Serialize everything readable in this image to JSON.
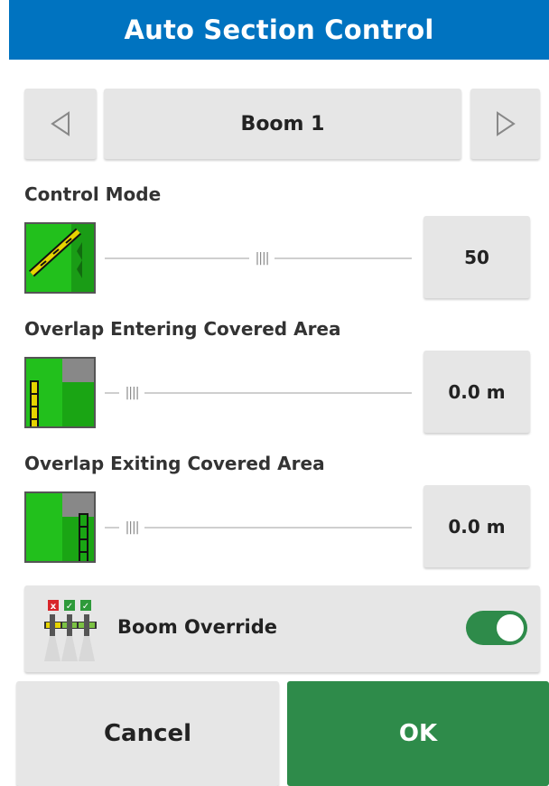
{
  "title": "Auto Section Control",
  "boom_selector": {
    "prev_icon": "triangle-left-icon",
    "next_icon": "triangle-right-icon",
    "label": "Boom 1"
  },
  "control_mode": {
    "label": "Control Mode",
    "icon": "control-mode-icon",
    "value": "50",
    "slider_fraction": 0.5
  },
  "overlap_entering": {
    "label": "Overlap Entering Covered Area",
    "icon": "overlap-entering-icon",
    "value": "0.0 m",
    "slider_fraction": 0.0
  },
  "overlap_exiting": {
    "label": "Overlap Exiting Covered Area",
    "icon": "overlap-exiting-icon",
    "value": "0.0 m",
    "slider_fraction": 0.0
  },
  "boom_override": {
    "label": "Boom Override",
    "icon": "boom-override-icon",
    "enabled": true
  },
  "actions": {
    "cancel_label": "Cancel",
    "ok_label": "OK"
  },
  "colors": {
    "title_bar": "#0073c0",
    "ok_button": "#2e8b4a",
    "toggle_on": "#2e8b4a",
    "field_green": "#22c01c",
    "indicator_yellow": "#e6d400"
  }
}
